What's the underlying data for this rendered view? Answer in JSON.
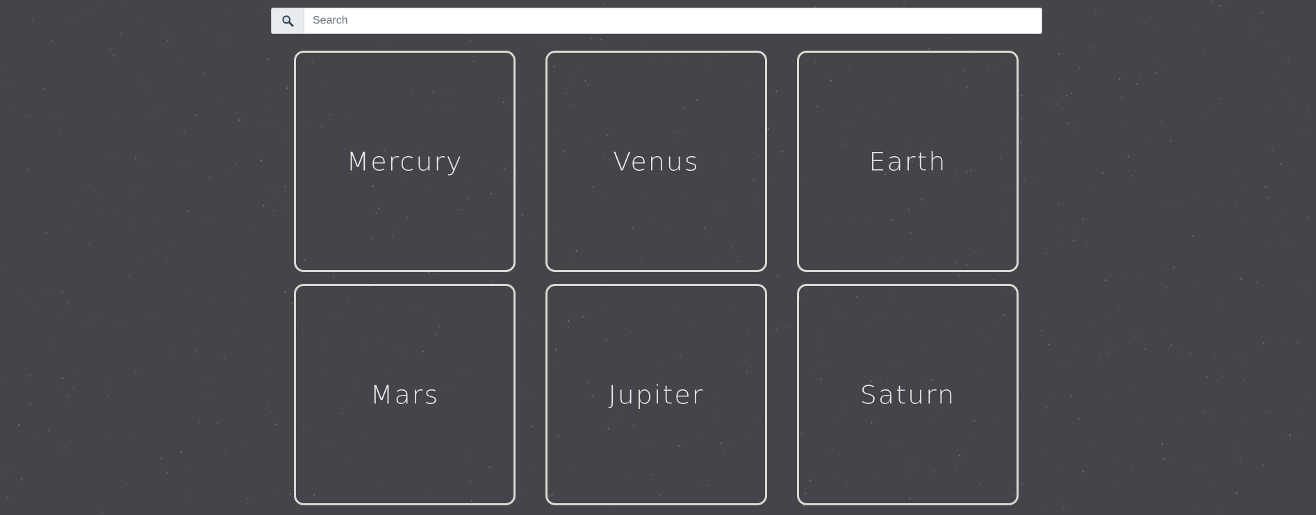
{
  "search": {
    "placeholder": "Search",
    "value": "",
    "icon": "magnifier-icon"
  },
  "planets": [
    {
      "name": "Mercury"
    },
    {
      "name": "Venus"
    },
    {
      "name": "Earth"
    },
    {
      "name": "Mars"
    },
    {
      "name": "Jupiter"
    },
    {
      "name": "Saturn"
    }
  ],
  "colors": {
    "background": "#45444a",
    "card_border": "#dcd7d0",
    "card_text": "#ece9e6",
    "search_addon_bg": "#e9ecef"
  }
}
